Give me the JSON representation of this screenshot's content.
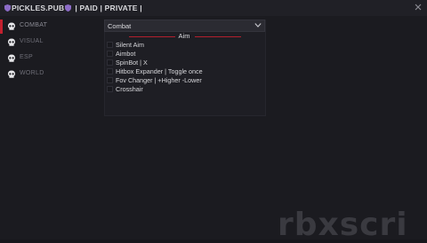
{
  "title": {
    "name": "PICKLES.PUB",
    "tags": "| PAID | PRIVATE |"
  },
  "sidebar": {
    "items": [
      {
        "label": "COMBAT",
        "icon": "skull-icon",
        "active": true
      },
      {
        "label": "VISUAL",
        "icon": "skull-icon",
        "active": false
      },
      {
        "label": "ESP",
        "icon": "skull-icon",
        "active": false
      },
      {
        "label": "WORLD",
        "icon": "skull-icon",
        "active": false
      }
    ]
  },
  "main": {
    "dropdown_value": "Combat",
    "section_title": "Aim",
    "options": [
      {
        "label": "Silent Aim",
        "checked": false
      },
      {
        "label": "Aimbot",
        "checked": false
      },
      {
        "label": "SpinBot | X",
        "checked": false
      },
      {
        "label": "Hitbox Expander | Toggle once",
        "checked": false
      },
      {
        "label": "Fov Changer | +Higher -Lower",
        "checked": false
      },
      {
        "label": "Crosshair",
        "checked": false
      }
    ]
  },
  "watermark": "rbxscri",
  "colors": {
    "accent": "#c3202e",
    "background": "#1b1b20",
    "text": "#dcdce0",
    "muted": "#6f6f78"
  }
}
